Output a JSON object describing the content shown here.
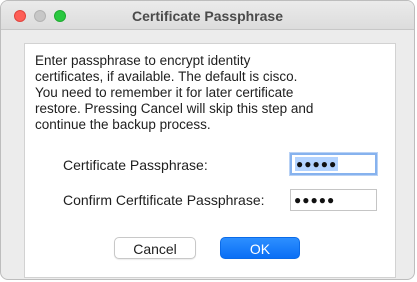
{
  "window": {
    "title": "Certificate Passphrase"
  },
  "message": "Enter passphrase to encrypt identity\ncertificates, if available. The default is cisco.\nYou need to remember it for later certificate\nrestore. Pressing Cancel will skip this step and\ncontinue the backup process.",
  "form": {
    "passphrase_label": "Certificate Passphrase:",
    "passphrase_value": "●●●●●",
    "confirm_label": "Confirm Cerftificate Passphrase:",
    "confirm_value": "●●●●●"
  },
  "buttons": {
    "cancel_label": "Cancel",
    "ok_label": "OK"
  },
  "colors": {
    "accent": "#0a6ff5",
    "close": "#fe5f57",
    "zoom": "#2ac840"
  },
  "icons": [
    "close-window-icon",
    "minimize-window-icon",
    "zoom-window-icon"
  ]
}
